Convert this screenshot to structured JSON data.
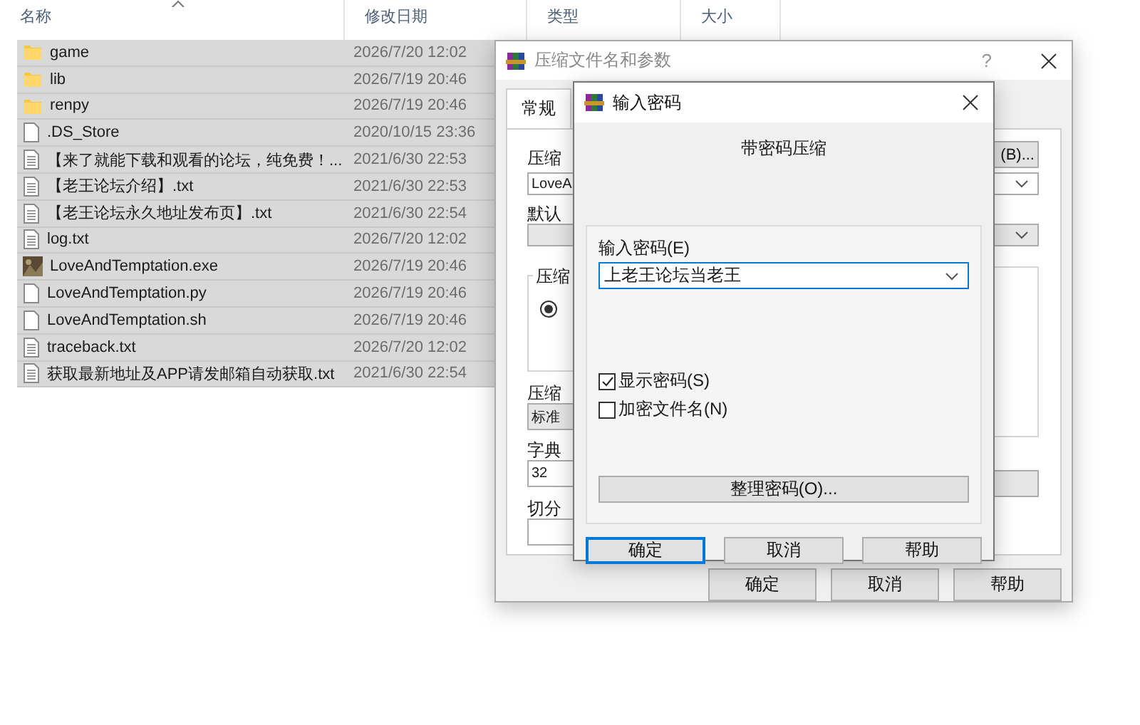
{
  "explorer": {
    "columns": [
      "名称",
      "修改日期",
      "类型",
      "大小"
    ],
    "rows": [
      {
        "name": "game",
        "date": "2026/7/20 12:02",
        "kind": "folder",
        "selected": true
      },
      {
        "name": "lib",
        "date": "2026/7/19 20:46",
        "kind": "folder",
        "selected": true
      },
      {
        "name": "renpy",
        "date": "2026/7/19 20:46",
        "kind": "folder",
        "selected": true
      },
      {
        "name": ".DS_Store",
        "date": "2020/10/15 23:36",
        "kind": "file",
        "selected": true
      },
      {
        "name": "【来了就能下载和观看的论坛，纯免费！...",
        "date": "2021/6/30 22:53",
        "kind": "text",
        "selected": true
      },
      {
        "name": "【老王论坛介绍】.txt",
        "date": "2021/6/30 22:53",
        "kind": "text",
        "selected": true
      },
      {
        "name": "【老王论坛永久地址发布页】.txt",
        "date": "2021/6/30 22:54",
        "kind": "text",
        "selected": true
      },
      {
        "name": "log.txt",
        "date": "2026/7/20 12:02",
        "kind": "text",
        "selected": true
      },
      {
        "name": "LoveAndTemptation.exe",
        "date": "2026/7/19 20:46",
        "kind": "app",
        "selected": true
      },
      {
        "name": "LoveAndTemptation.py",
        "date": "2026/7/19 20:46",
        "kind": "file",
        "selected": true
      },
      {
        "name": "LoveAndTemptation.sh",
        "date": "2026/7/19 20:46",
        "kind": "file",
        "selected": true
      },
      {
        "name": "traceback.txt",
        "date": "2026/7/20 12:02",
        "kind": "text",
        "selected": true
      },
      {
        "name": "获取最新地址及APP请发邮箱自动获取.txt",
        "date": "2021/6/30 22:54",
        "kind": "text",
        "selected": true
      }
    ]
  },
  "archive_dialog": {
    "title": "压缩文件名和参数",
    "help": "?",
    "tabs": [
      {
        "label": "常规",
        "selected": true
      }
    ],
    "name_label": "压缩",
    "browse_button": "(B)...",
    "name_value": "LoveA",
    "profile_label": "默认",
    "group_label": "压缩",
    "radio_checked": true,
    "method_label": "压缩",
    "method_value": "标准",
    "dict_label": "字典",
    "dict_value": "32",
    "split_label": "切分",
    "buttons": [
      "确定",
      "取消",
      "帮助"
    ]
  },
  "password_dialog": {
    "title": "输入密码",
    "heading": "带密码压缩",
    "password_label": "输入密码(E)",
    "password_value": "上老王论坛当老王",
    "checkboxes": [
      {
        "label": "显示密码(S)",
        "checked": true
      },
      {
        "label": "加密文件名(N)",
        "checked": false
      }
    ],
    "manage_button": "整理密码(O)...",
    "buttons": [
      {
        "label": "确定",
        "default": true
      },
      {
        "label": "取消",
        "default": false
      },
      {
        "label": "帮助",
        "default": false
      }
    ]
  }
}
